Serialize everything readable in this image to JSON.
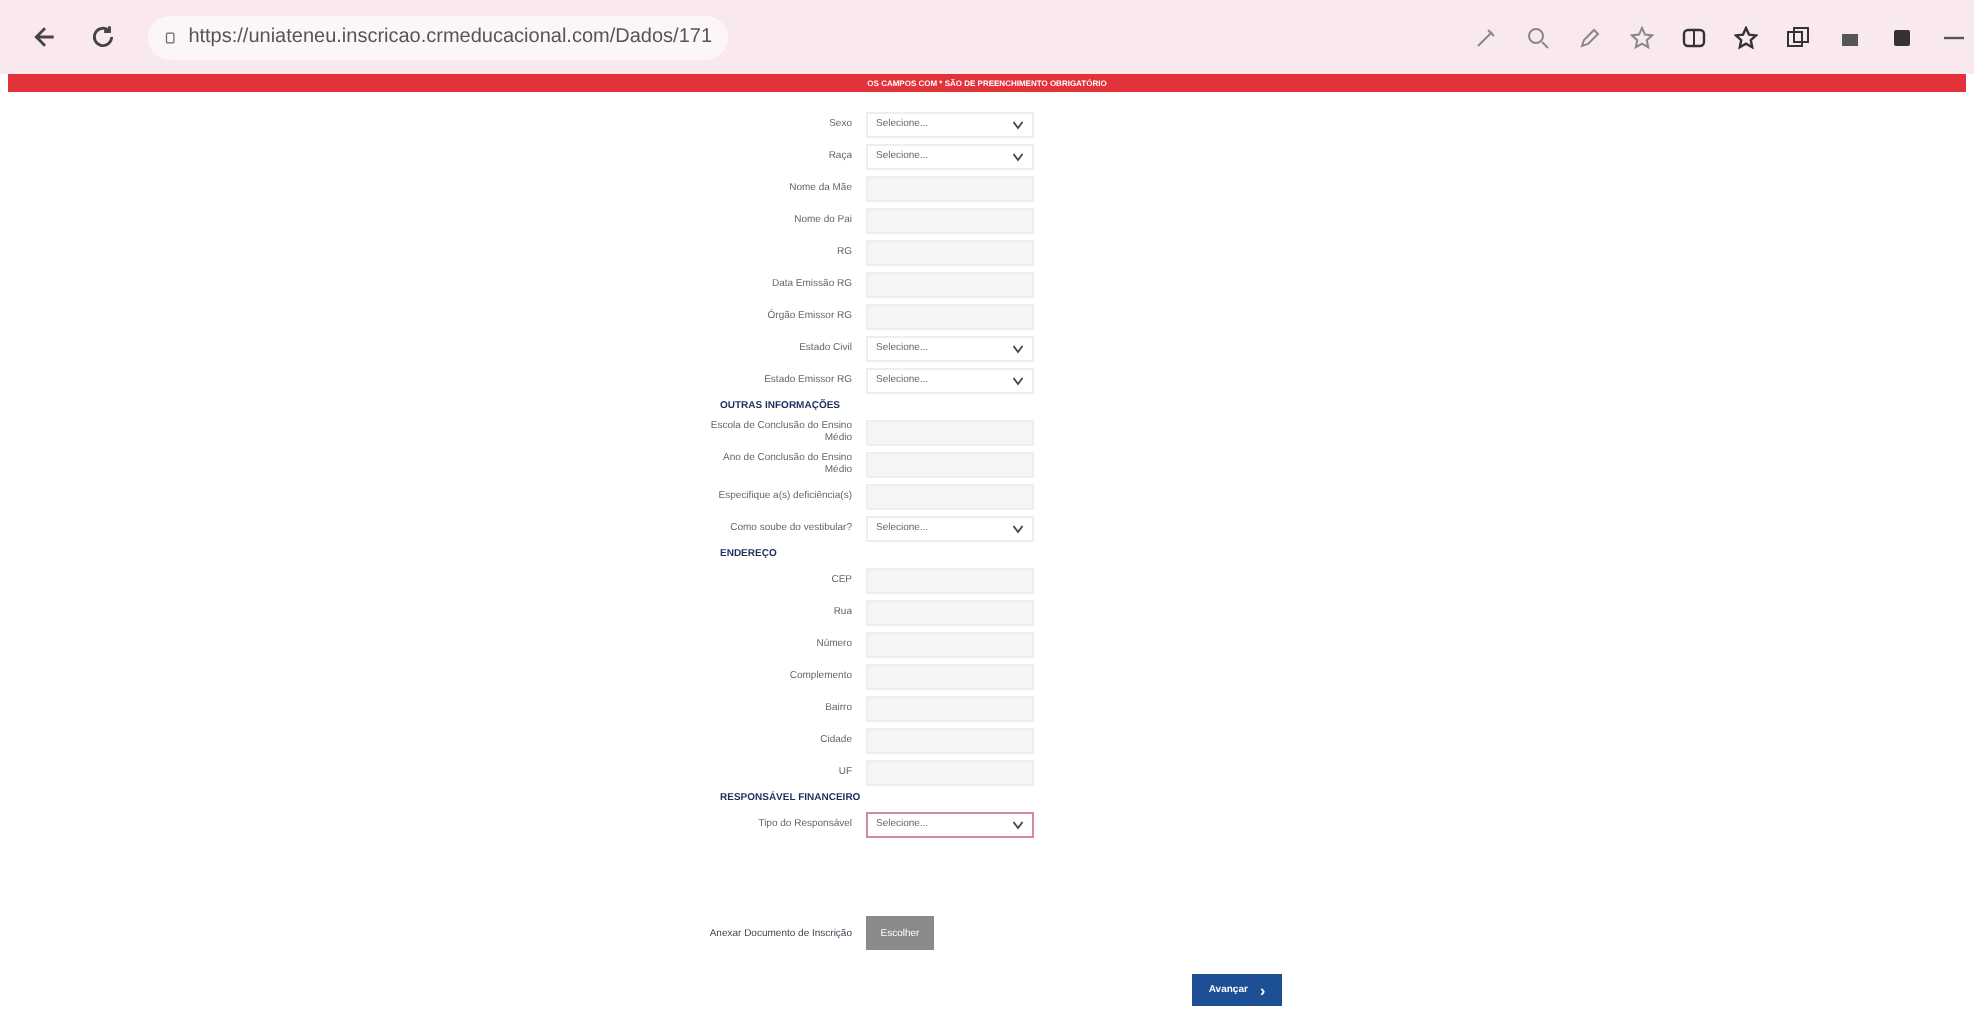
{
  "browser": {
    "url": "https://uniateneu.inscricao.crmeducacional.com/Dados/171"
  },
  "banner": "OS CAMPOS COM * SÃO DE PREENCHIMENTO OBRIGATÓRIO",
  "sections": [
    {
      "fields": [
        {
          "label": "Sexo",
          "kind": "select",
          "value": "Selecione..."
        },
        {
          "label": "Raça",
          "kind": "select",
          "value": "Selecione..."
        },
        {
          "label": "Nome da Mãe",
          "kind": "text"
        },
        {
          "label": "Nome do Pai",
          "kind": "text"
        },
        {
          "label": "RG",
          "kind": "text"
        },
        {
          "label": "Data Emissão RG",
          "kind": "text"
        },
        {
          "label": "Órgão Emissor RG",
          "kind": "text"
        },
        {
          "label": "Estado Civil",
          "kind": "select",
          "value": "Selecione..."
        },
        {
          "label": "Estado Emissor RG",
          "kind": "select",
          "value": "Selecione..."
        }
      ]
    },
    {
      "heading": "OUTRAS INFORMAÇÕES",
      "fields": [
        {
          "label": "Escola de Conclusão do Ensino Médio",
          "kind": "text"
        },
        {
          "label": "Ano de Conclusão do Ensino Médio",
          "kind": "text"
        },
        {
          "label": "Especifique a(s) deficiência(s)",
          "kind": "text"
        },
        {
          "label": "Como soube do vestibular?",
          "kind": "select",
          "value": "Selecione..."
        }
      ]
    },
    {
      "heading": "ENDEREÇO",
      "fields": [
        {
          "label": "CEP",
          "kind": "text"
        },
        {
          "label": "Rua",
          "kind": "text"
        },
        {
          "label": "Número",
          "kind": "text"
        },
        {
          "label": "Complemento",
          "kind": "text"
        },
        {
          "label": "Bairro",
          "kind": "text"
        },
        {
          "label": "Cidade",
          "kind": "text"
        },
        {
          "label": "UF",
          "kind": "text"
        }
      ]
    },
    {
      "heading": "RESPONSÁVEL FINANCEIRO",
      "fields": [
        {
          "label": "Tipo do Responsável",
          "kind": "select",
          "value": "Selecione...",
          "error": true
        }
      ]
    }
  ],
  "upload": {
    "label": "Anexar Documento de Inscrição",
    "button": "Escolher"
  },
  "next_button": {
    "label": "Avançar",
    "icon": "›"
  }
}
